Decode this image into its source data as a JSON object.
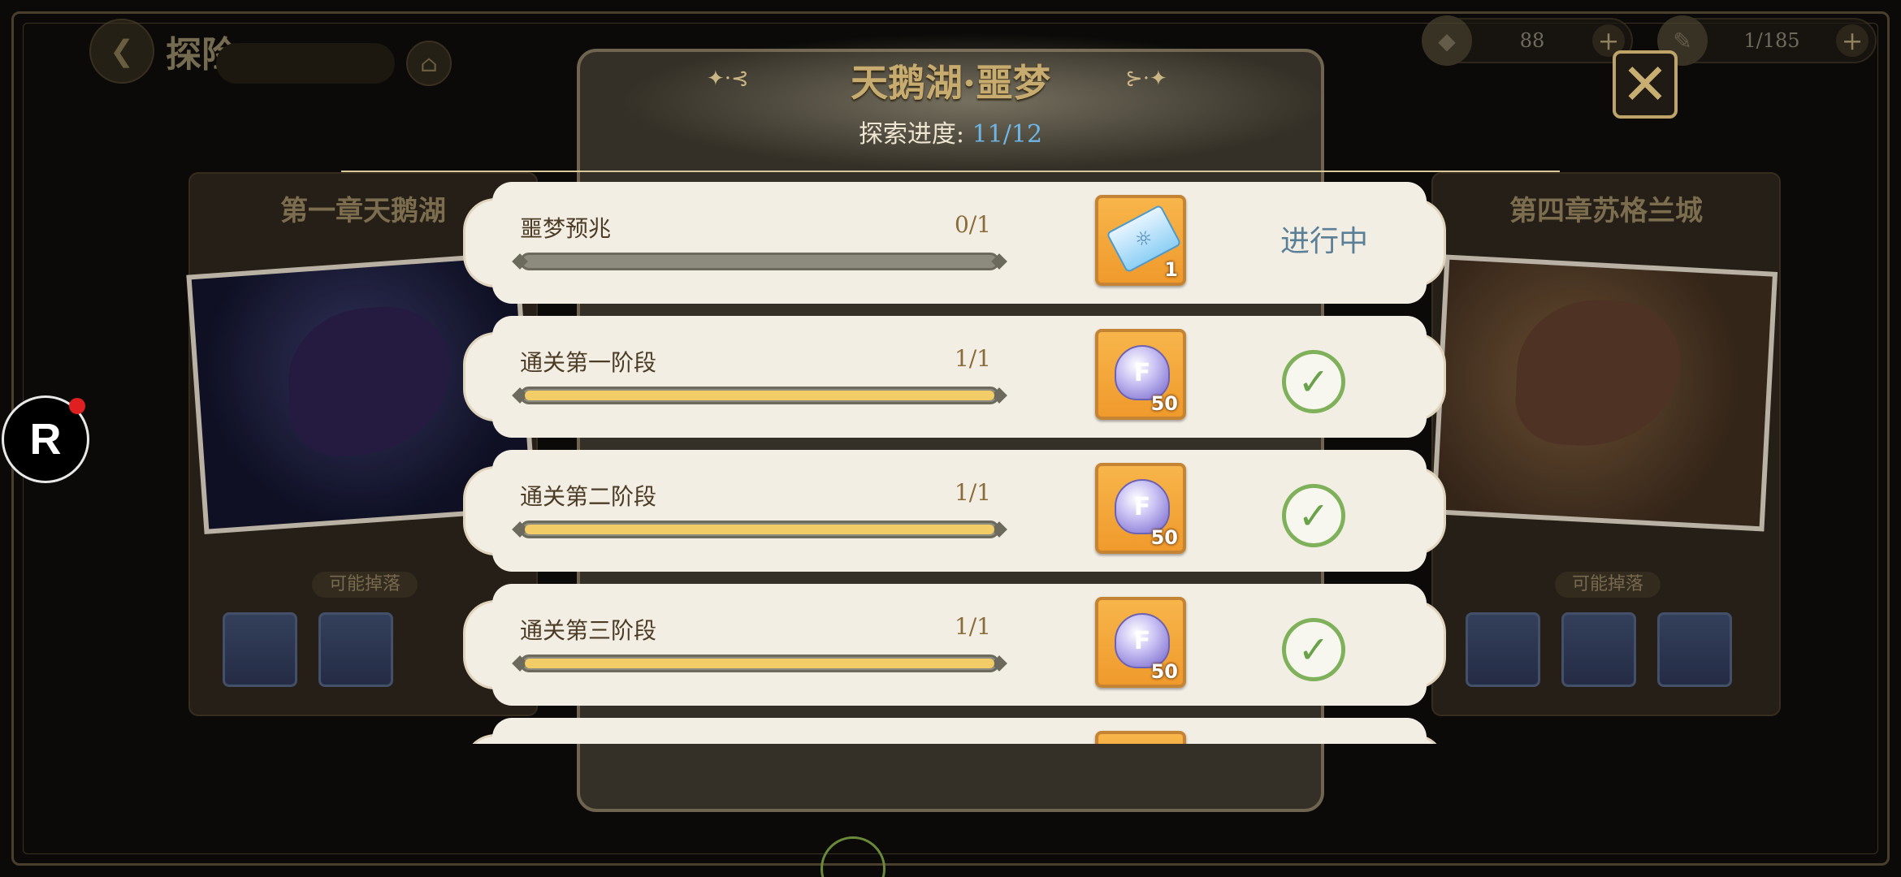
{
  "top_nav": {
    "title": "探险"
  },
  "resources": [
    {
      "icon": "stamina-crystal-icon",
      "value": "88"
    },
    {
      "icon": "ticket-icon",
      "value": "1/185"
    }
  ],
  "chapters": [
    {
      "title": "第一章天鹅湖",
      "drops_label": "可能掉落",
      "art": "raven"
    },
    {
      "title": "第四章苏格兰城",
      "drops_label": "可能掉落",
      "art": "beast"
    }
  ],
  "modal": {
    "title": "天鹅湖·噩梦",
    "progress_label": "探索进度:",
    "progress_value": "11/12",
    "quests": [
      {
        "name": "噩梦预兆",
        "count": "0/1",
        "progress": 0,
        "reward": "ticket-icon",
        "reward_qty": "1",
        "status": "进行中",
        "done": false
      },
      {
        "name": "通关第一阶段",
        "count": "1/1",
        "progress": 1,
        "reward": "gem-icon",
        "reward_qty": "50",
        "status": "",
        "done": true
      },
      {
        "name": "通关第二阶段",
        "count": "1/1",
        "progress": 1,
        "reward": "gem-icon",
        "reward_qty": "50",
        "status": "",
        "done": true
      },
      {
        "name": "通关第三阶段",
        "count": "1/1",
        "progress": 1,
        "reward": "gem-icon",
        "reward_qty": "50",
        "status": "",
        "done": true
      }
    ]
  },
  "colors": {
    "progress_value": "#6fb6e6",
    "bar_fill": "#f2cc66",
    "check": "#7fb05a",
    "title": "#c8ab6e"
  }
}
